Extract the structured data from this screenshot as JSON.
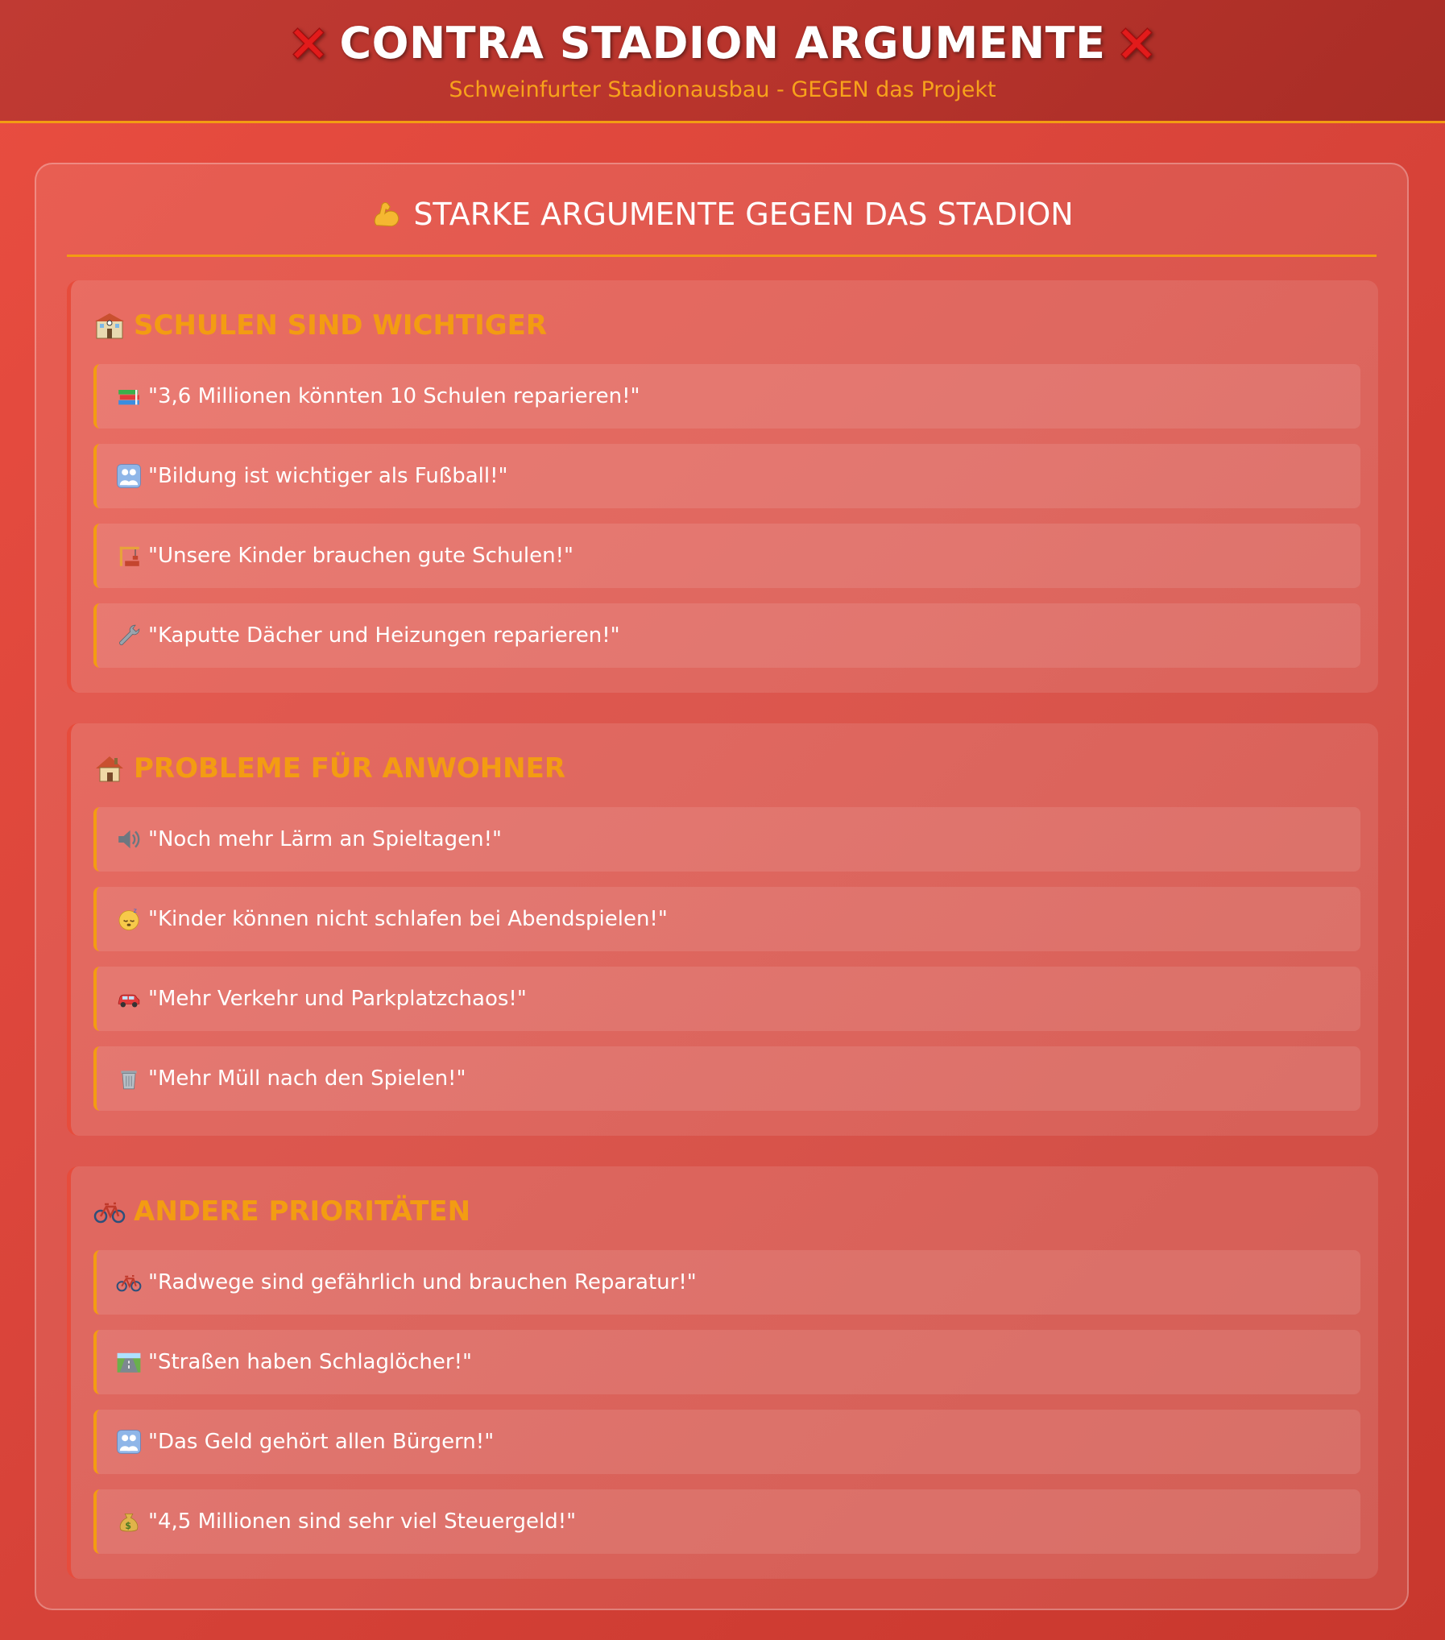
{
  "header": {
    "title": "CONTRA STADION ARGUMENTE",
    "left_icon": "cross-mark-icon",
    "right_icon": "cross-mark-icon",
    "subtitle": "Schweinfurter Stadionausbau - GEGEN das Projekt"
  },
  "panel": {
    "title": "STARKE ARGUMENTE GEGEN DAS STADION",
    "title_icon": "flexed-biceps-icon"
  },
  "sections": [
    {
      "heading": "SCHULEN SIND WICHTIGER",
      "icon": "school-icon",
      "items": [
        {
          "icon": "books-icon",
          "text": "\"3,6 Millionen könnten 10 Schulen reparieren!\""
        },
        {
          "icon": "family-icon",
          "text": "\"Bildung ist wichtiger als Fußball!\""
        },
        {
          "icon": "construction-icon",
          "text": "\"Unsere Kinder brauchen gute Schulen!\""
        },
        {
          "icon": "wrench-icon",
          "text": "\"Kaputte Dächer und Heizungen reparieren!\""
        }
      ]
    },
    {
      "heading": "PROBLEME FÜR ANWOHNER",
      "icon": "house-icon",
      "items": [
        {
          "icon": "speaker-icon",
          "text": "\"Noch mehr Lärm an Spieltagen!\""
        },
        {
          "icon": "sleeping-face-icon",
          "text": "\"Kinder können nicht schlafen bei Abendspielen!\""
        },
        {
          "icon": "car-icon",
          "text": "\"Mehr Verkehr und Parkplatzchaos!\""
        },
        {
          "icon": "trash-can-icon",
          "text": "\"Mehr Müll nach den Spielen!\""
        }
      ]
    },
    {
      "heading": "ANDERE PRIORITÄTEN",
      "icon": "bicycle-icon",
      "items": [
        {
          "icon": "bicycle-icon",
          "text": "\"Radwege sind gefährlich und brauchen Reparatur!\""
        },
        {
          "icon": "road-icon",
          "text": "\"Straßen haben Schlaglöcher!\""
        },
        {
          "icon": "family-icon",
          "text": "\"Das Geld gehört allen Bürgern!\""
        },
        {
          "icon": "money-bag-icon",
          "text": "\"4,5 Millionen sind sehr viel Steuergeld!\""
        }
      ]
    }
  ],
  "colors": {
    "background": "#e04a3e",
    "header_background": "#b8342c",
    "accent": "#f39c12",
    "text": "#ffffff"
  }
}
